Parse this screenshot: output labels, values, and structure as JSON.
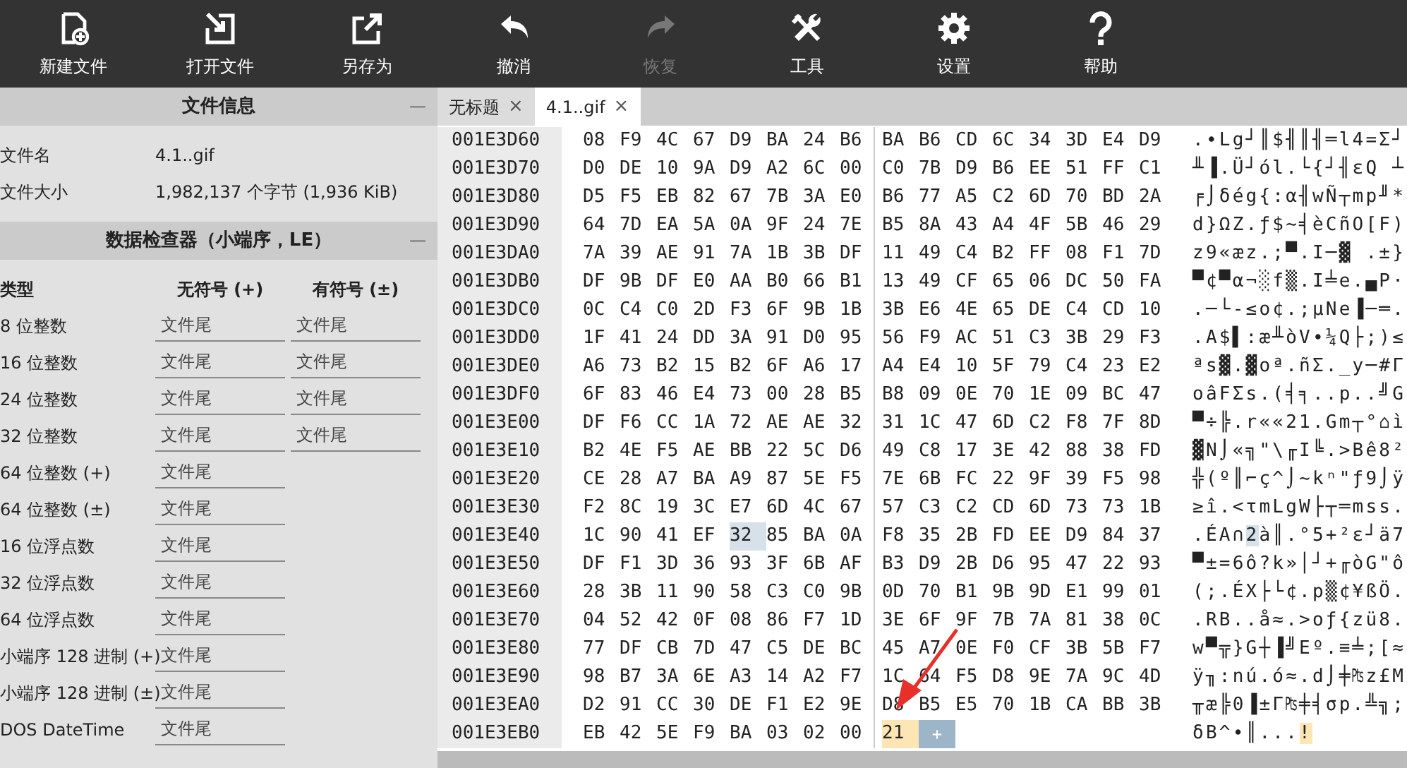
{
  "toolbar": [
    {
      "kind": "new",
      "label": "新建文件",
      "disabled": false
    },
    {
      "kind": "open",
      "label": "打开文件",
      "disabled": false
    },
    {
      "kind": "saveas",
      "label": "另存为",
      "disabled": false
    },
    {
      "kind": "undo",
      "label": "撤消",
      "disabled": false
    },
    {
      "kind": "redo",
      "label": "恢复",
      "disabled": true
    },
    {
      "kind": "tools",
      "label": "工具",
      "disabled": false
    },
    {
      "kind": "settings",
      "label": "设置",
      "disabled": false
    },
    {
      "kind": "help",
      "label": "帮助",
      "disabled": false
    }
  ],
  "file_info": {
    "title": "文件信息",
    "collapse": "—",
    "rows": [
      {
        "label": "文件名",
        "value": "4.1..gif"
      },
      {
        "label": "文件大小",
        "value": "1,982,137 个字节 (1,936 KiB)"
      }
    ]
  },
  "inspector": {
    "title": "数据检查器（小端序，LE）",
    "collapse": "—",
    "columns": [
      "类型",
      "无符号 (+)",
      "有符号 (±)"
    ],
    "rows": [
      {
        "type": "8 位整数",
        "unsigned": "文件尾",
        "signed": "文件尾"
      },
      {
        "type": "16 位整数",
        "unsigned": "文件尾",
        "signed": "文件尾"
      },
      {
        "type": "24 位整数",
        "unsigned": "文件尾",
        "signed": "文件尾"
      },
      {
        "type": "32 位整数",
        "unsigned": "文件尾",
        "signed": "文件尾"
      },
      {
        "type": "64 位整数 (+)",
        "unsigned": "文件尾"
      },
      {
        "type": "64 位整数 (±)",
        "unsigned": "文件尾"
      },
      {
        "type": "16 位浮点数",
        "unsigned": "文件尾"
      },
      {
        "type": "32 位浮点数",
        "unsigned": "文件尾"
      },
      {
        "type": "64 位浮点数",
        "unsigned": "文件尾"
      },
      {
        "type": "小端序 128 进制 (+)",
        "unsigned": "文件尾"
      },
      {
        "type": "小端序 128 进制 (±)",
        "unsigned": "文件尾"
      },
      {
        "type": "DOS DateTime",
        "unsigned": "文件尾"
      }
    ]
  },
  "tabs": [
    {
      "label": "无标题",
      "close": "×",
      "selected": false
    },
    {
      "label": "4.1..gif",
      "close": "×",
      "selected": true
    }
  ],
  "hex_view": {
    "annotation_arrow": true,
    "append_button": "+",
    "rows": [
      {
        "address": "001E3D60",
        "bytes": [
          "08",
          "F9",
          "4C",
          "67",
          "D9",
          "BA",
          "24",
          "B6",
          "BA",
          "B6",
          "CD",
          "6C",
          "34",
          "3D",
          "E4",
          "D9"
        ],
        "text": ".∙Lg┘║$╢║╢═l4=Σ┘"
      },
      {
        "address": "001E3D70",
        "bytes": [
          "D0",
          "DE",
          "10",
          "9A",
          "D9",
          "A2",
          "6C",
          "00",
          "C0",
          "7B",
          "D9",
          "B6",
          "EE",
          "51",
          "FF",
          "C1"
        ],
        "text": "╨▐.Ü┘ól.└{┘╢εQ ┴"
      },
      {
        "address": "001E3D80",
        "bytes": [
          "D5",
          "F5",
          "EB",
          "82",
          "67",
          "7B",
          "3A",
          "E0",
          "B6",
          "77",
          "A5",
          "C2",
          "6D",
          "70",
          "BD",
          "2A"
        ],
        "text": "╒⌡δég{:α╢wÑ┬mp╜*"
      },
      {
        "address": "001E3D90",
        "bytes": [
          "64",
          "7D",
          "EA",
          "5A",
          "0A",
          "9F",
          "24",
          "7E",
          "B5",
          "8A",
          "43",
          "A4",
          "4F",
          "5B",
          "46",
          "29"
        ],
        "text": "d}ΩZ.ƒ$~╡èCñO[F)"
      },
      {
        "address": "001E3DA0",
        "bytes": [
          "7A",
          "39",
          "AE",
          "91",
          "7A",
          "1B",
          "3B",
          "DF",
          "11",
          "49",
          "C4",
          "B2",
          "FF",
          "08",
          "F1",
          "7D"
        ],
        "text": "z9«æz.;▀.I─▓ .±}"
      },
      {
        "address": "001E3DB0",
        "bytes": [
          "DF",
          "9B",
          "DF",
          "E0",
          "AA",
          "B0",
          "66",
          "B1",
          "13",
          "49",
          "CF",
          "65",
          "06",
          "DC",
          "50",
          "FA"
        ],
        "text": "▀¢▀α¬░f▒.I╧e.▄P·"
      },
      {
        "address": "001E3DC0",
        "bytes": [
          "0C",
          "C4",
          "C0",
          "2D",
          "F3",
          "6F",
          "9B",
          "1B",
          "3B",
          "E6",
          "4E",
          "65",
          "DE",
          "C4",
          "CD",
          "10"
        ],
        "text": ".─└-≤o¢.;µNe▐─═."
      },
      {
        "address": "001E3DD0",
        "bytes": [
          "1F",
          "41",
          "24",
          "DD",
          "3A",
          "91",
          "D0",
          "95",
          "56",
          "F9",
          "AC",
          "51",
          "C3",
          "3B",
          "29",
          "F3"
        ],
        "text": ".A$▌:æ╨òV∙¼Q├;)≤"
      },
      {
        "address": "001E3DE0",
        "bytes": [
          "A6",
          "73",
          "B2",
          "15",
          "B2",
          "6F",
          "A6",
          "17",
          "A4",
          "E4",
          "10",
          "5F",
          "79",
          "C4",
          "23",
          "E2"
        ],
        "text": "ªs▓.▓oª.ñΣ._y─#Γ"
      },
      {
        "address": "001E3DF0",
        "bytes": [
          "6F",
          "83",
          "46",
          "E4",
          "73",
          "00",
          "28",
          "B5",
          "B8",
          "09",
          "0E",
          "70",
          "1E",
          "09",
          "BC",
          "47"
        ],
        "text": "oâFΣs.(╡╕..p..╝G"
      },
      {
        "address": "001E3E00",
        "bytes": [
          "DF",
          "F6",
          "CC",
          "1A",
          "72",
          "AE",
          "AE",
          "32",
          "31",
          "1C",
          "47",
          "6D",
          "C2",
          "F8",
          "7F",
          "8D"
        ],
        "text": "▀÷╠.r««21.Gm┬°⌂ì"
      },
      {
        "address": "001E3E10",
        "bytes": [
          "B2",
          "4E",
          "F5",
          "AE",
          "BB",
          "22",
          "5C",
          "D6",
          "49",
          "C8",
          "17",
          "3E",
          "42",
          "88",
          "38",
          "FD"
        ],
        "text": "▓N⌡«╗\"\\╓I╚.>Bê8²"
      },
      {
        "address": "001E3E20",
        "bytes": [
          "CE",
          "28",
          "A7",
          "BA",
          "A9",
          "87",
          "5E",
          "F5",
          "7E",
          "6B",
          "FC",
          "22",
          "9F",
          "39",
          "F5",
          "98"
        ],
        "text": "╬(º║⌐ç^⌡~kⁿ\"ƒ9⌡ÿ"
      },
      {
        "address": "001E3E30",
        "bytes": [
          "F2",
          "8C",
          "19",
          "3C",
          "E7",
          "6D",
          "4C",
          "67",
          "57",
          "C3",
          "C2",
          "CD",
          "6D",
          "73",
          "73",
          "1B"
        ],
        "text": "≥î.<τmLgW├┬═mss."
      },
      {
        "address": "001E3E40",
        "bytes": [
          "1C",
          "90",
          "41",
          "EF",
          {
            "hex": "32",
            "hovered": true,
            "cursor": false
          },
          "85",
          "BA",
          "0A",
          "F8",
          "35",
          "2B",
          "FD",
          "EE",
          "D9",
          "84",
          "37"
        ],
        "text": ".ÉA∩2à║.°5+²ε┘ä7"
      },
      {
        "address": "001E3E50",
        "bytes": [
          "DF",
          "F1",
          "3D",
          "36",
          "93",
          "3F",
          "6B",
          "AF",
          "B3",
          "D9",
          "2B",
          "D6",
          "95",
          "47",
          "22",
          "93"
        ],
        "text": "▀±=6ô?k»│┘+╓òG\"ô"
      },
      {
        "address": "001E3E60",
        "bytes": [
          "28",
          "3B",
          "11",
          "90",
          "58",
          "C3",
          "C0",
          "9B",
          "0D",
          "70",
          "B1",
          "9B",
          "9D",
          "E1",
          "99",
          "01"
        ],
        "text": "(;.ÉX├└¢.p▒¢¥ßÖ."
      },
      {
        "address": "001E3E70",
        "bytes": [
          "04",
          "52",
          "42",
          "0F",
          "08",
          "86",
          "F7",
          "1D",
          "3E",
          "6F",
          "9F",
          "7B",
          "7A",
          "81",
          "38",
          "0C"
        ],
        "text": ".RB..å≈.>oƒ{zü8."
      },
      {
        "address": "001E3E80",
        "bytes": [
          "77",
          "DF",
          "CB",
          "7D",
          "47",
          "C5",
          "DE",
          "BC",
          "45",
          "A7",
          "0E",
          "F0",
          "CF",
          "3B",
          "5B",
          "F7"
        ],
        "text": "w▀╦}G┼▐╝Eº.≡╧;[≈"
      },
      {
        "address": "001E3E90",
        "bytes": [
          "98",
          "B7",
          "3A",
          "6E",
          "A3",
          "14",
          "A2",
          "F7",
          "1C",
          "64",
          "F5",
          "D8",
          "9E",
          "7A",
          "9C",
          "4D"
        ],
        "text": "ÿ╖:nú.ó≈.d⌡╪₧z£M"
      },
      {
        "address": "001E3EA0",
        "bytes": [
          "D2",
          "91",
          "CC",
          "30",
          "DE",
          "F1",
          "E2",
          "9E",
          "D8",
          "B5",
          "E5",
          "70",
          "1B",
          "CA",
          "BB",
          "3B"
        ],
        "text": "╥æ╠0▐±Γ₧╪╡σp.╩╗;"
      },
      {
        "address": "001E3EB0",
        "bytes": [
          "EB",
          "42",
          "5E",
          "F9",
          "BA",
          "03",
          "02",
          "00",
          {
            "hex": "21",
            "hovered": false,
            "cursor": true
          }
        ],
        "text": "δB^∙║...!"
      }
    ]
  }
}
